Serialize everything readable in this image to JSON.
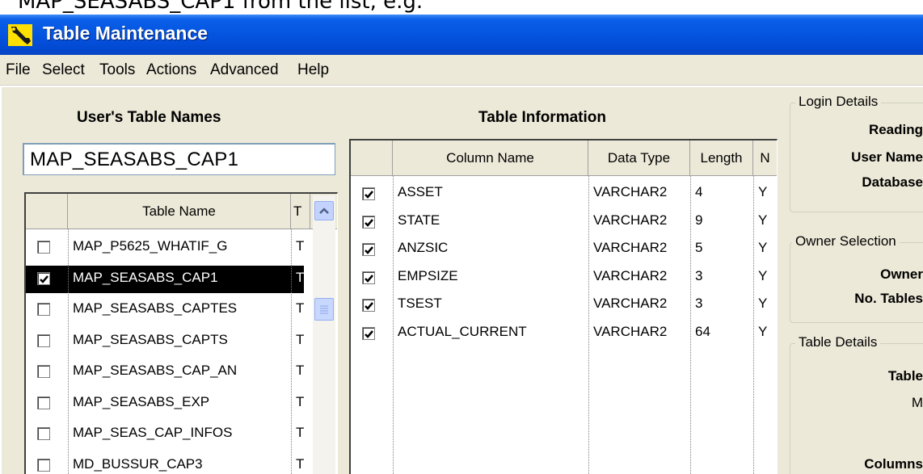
{
  "caption_text": "MAP_SEASABS_CAP1 from the list, e.g.",
  "window": {
    "title": "Table Maintenance"
  },
  "menu": [
    "File",
    "Select",
    "Tools",
    "Actions",
    "Advanced",
    "Help"
  ],
  "left_panel": {
    "heading": "User's Table Names",
    "selected_table": "MAP_SEASABS_CAP1",
    "columns": [
      "Table Name",
      "T"
    ],
    "rows": [
      {
        "name": "MAP_P5625_WHATIF_G",
        "type": "T",
        "checked": false,
        "selected": false
      },
      {
        "name": "MAP_SEASABS_CAP1",
        "type": "T",
        "checked": true,
        "selected": true
      },
      {
        "name": "MAP_SEASABS_CAPTES",
        "type": "T",
        "checked": false,
        "selected": false
      },
      {
        "name": "MAP_SEASABS_CAPTS",
        "type": "T",
        "checked": false,
        "selected": false
      },
      {
        "name": "MAP_SEASABS_CAP_AN",
        "type": "T",
        "checked": false,
        "selected": false
      },
      {
        "name": "MAP_SEASABS_EXP",
        "type": "T",
        "checked": false,
        "selected": false
      },
      {
        "name": "MAP_SEAS_CAP_INFOS",
        "type": "T",
        "checked": false,
        "selected": false
      },
      {
        "name": "MD_BUSSUR_CAP3",
        "type": "T",
        "checked": false,
        "selected": false
      }
    ]
  },
  "middle_panel": {
    "heading": "Table Information",
    "columns": [
      "Column Name",
      "Data Type",
      "Length",
      "N"
    ],
    "rows": [
      {
        "column": "ASSET",
        "type": "VARCHAR2",
        "length": "4",
        "nullable": "Y",
        "checked": true
      },
      {
        "column": "STATE",
        "type": "VARCHAR2",
        "length": "9",
        "nullable": "Y",
        "checked": true
      },
      {
        "column": "ANZSIC",
        "type": "VARCHAR2",
        "length": "5",
        "nullable": "Y",
        "checked": true
      },
      {
        "column": "EMPSIZE",
        "type": "VARCHAR2",
        "length": "3",
        "nullable": "Y",
        "checked": true
      },
      {
        "column": "TSEST",
        "type": "VARCHAR2",
        "length": "3",
        "nullable": "Y",
        "checked": true
      },
      {
        "column": "ACTUAL_CURRENT",
        "type": "VARCHAR2",
        "length": "64",
        "nullable": "Y",
        "checked": true
      }
    ]
  },
  "right_panel": {
    "login": {
      "legend": "Login Details",
      "labels": [
        "Reading",
        "User Name",
        "Database"
      ]
    },
    "owner": {
      "legend": "Owner Selection",
      "labels": [
        "Owner",
        "No. Tables"
      ]
    },
    "table": {
      "legend": "Table Details",
      "labels": [
        "Table",
        "M",
        "Columns"
      ]
    }
  },
  "colors": {
    "titlebar": "#0454e0",
    "face": "#ece9d8",
    "selection": "#000000"
  }
}
